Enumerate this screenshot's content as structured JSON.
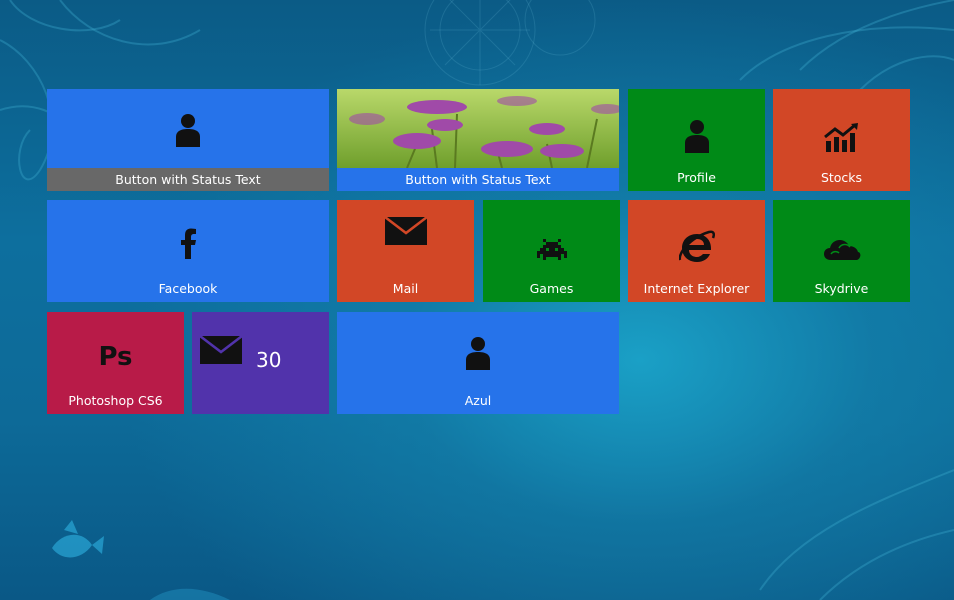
{
  "colors": {
    "blue": "#2673ea",
    "red": "#d24726",
    "green": "#008a17",
    "crimson": "#b81b48",
    "purple": "#5133ab",
    "status_gray": "#686868",
    "status_blue": "#2673ea"
  },
  "tiles": [
    {
      "name": "tile-button-status-gray",
      "icon": "person-icon",
      "label": "Button with Status Text"
    },
    {
      "name": "tile-button-status-image",
      "icon": "flower-photo",
      "label": "Button with Status Text"
    },
    {
      "name": "tile-profile",
      "icon": "person-icon",
      "label": "Profile"
    },
    {
      "name": "tile-stocks",
      "icon": "stocks-icon",
      "label": "Stocks"
    },
    {
      "name": "tile-facebook",
      "icon": "facebook-icon",
      "label": "Facebook"
    },
    {
      "name": "tile-mail",
      "icon": "mail-icon",
      "label": "Mail"
    },
    {
      "name": "tile-games",
      "icon": "games-icon",
      "label": "Games"
    },
    {
      "name": "tile-internet-explorer",
      "icon": "internet-explorer-icon",
      "label": "Internet Explorer"
    },
    {
      "name": "tile-skydrive",
      "icon": "skydrive-icon",
      "label": "Skydrive"
    },
    {
      "name": "tile-photoshop",
      "icon": "photoshop-icon",
      "icon_text": "Ps",
      "label": "Photoshop CS6"
    },
    {
      "name": "tile-mail-count",
      "icon": "mail-icon",
      "count": "30"
    },
    {
      "name": "tile-azul",
      "icon": "person-icon",
      "label": "Azul"
    }
  ]
}
